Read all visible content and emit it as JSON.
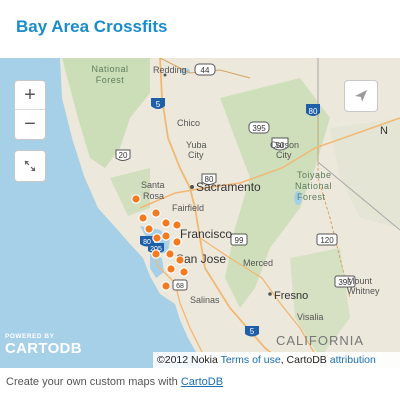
{
  "title": "Bay Area Crossfits",
  "map": {
    "controls": {
      "zoom_in": "+",
      "zoom_out": "−"
    },
    "labels": {
      "national_forest_top": [
        "National",
        "Forest"
      ],
      "toiyabe_forest": [
        "Toiyabe",
        "National",
        "Forest"
      ],
      "redding": "Redding",
      "chico": "Chico",
      "yuba_city": [
        "Yuba",
        "City"
      ],
      "carson_city": [
        "Carson",
        "City"
      ],
      "santa_rosa": [
        "Santa",
        "Rosa"
      ],
      "sacramento": "Sacramento",
      "fairfield": "Fairfield",
      "francisco": "Francisco",
      "san_jose": "San Jose",
      "merced": "Merced",
      "fresno": "Fresno",
      "salinas": "Salinas",
      "visalia": "Visalia",
      "mount_whitney": [
        "Mount",
        "Whitney"
      ],
      "california": "CALIFORNIA",
      "n_edge": "N"
    },
    "route_shields": [
      "44",
      "5",
      "395",
      "50",
      "80",
      "20",
      "80",
      "205",
      "99",
      "120",
      "395",
      "5",
      "68",
      "80"
    ],
    "markers_count": 15,
    "attribution": {
      "copyright": "©2012 Nokia",
      "terms": "Terms of use",
      "cartodb": "CartoDB",
      "attribution": "attribution"
    },
    "logo": {
      "powered_by": "POWERED BY",
      "name": "CARTODB"
    },
    "colors": {
      "water": "#a6cfe8",
      "land": "#ede8dc",
      "forest": "#c4dcb0",
      "marker": "#f47a20"
    }
  },
  "footer": {
    "text": "Create your own custom maps with ",
    "link": "CartoDB"
  }
}
